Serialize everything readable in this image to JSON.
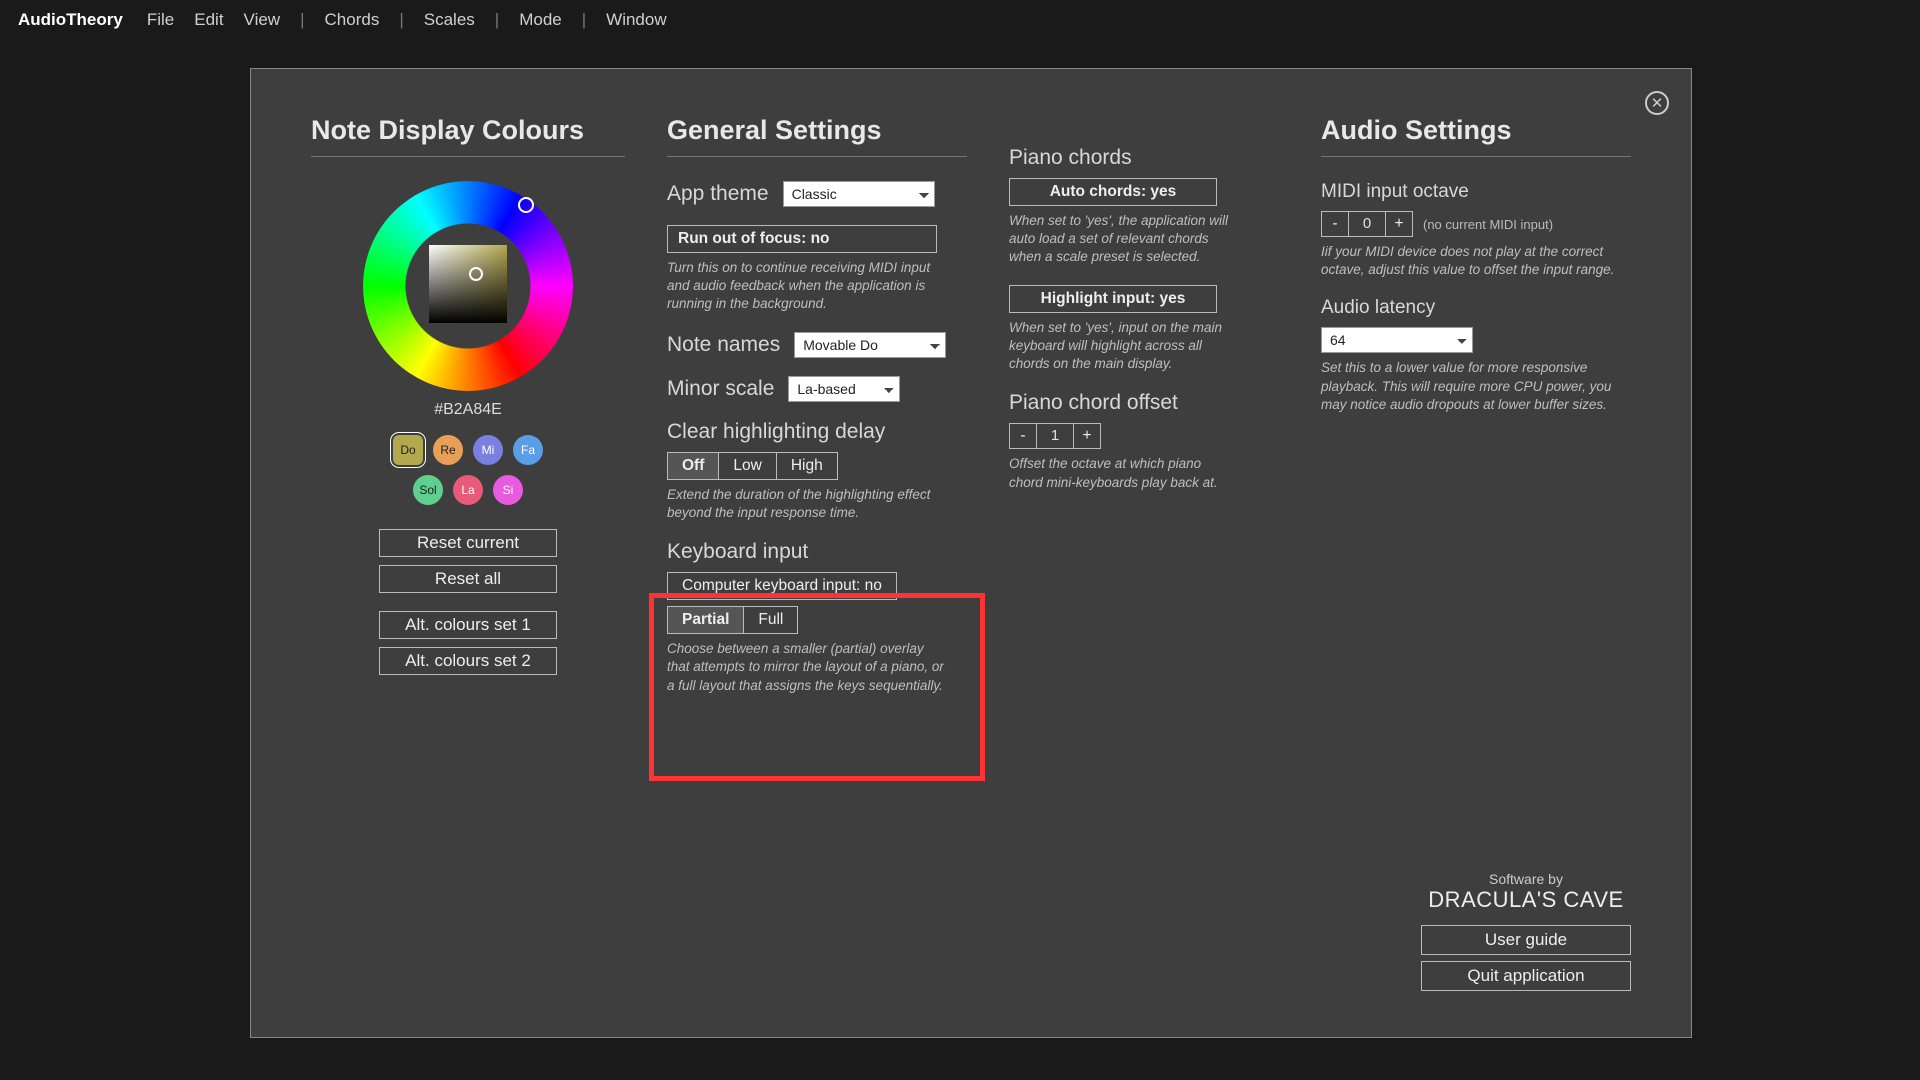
{
  "menubar": {
    "brand": "AudioTheory",
    "items": [
      "File",
      "Edit",
      "View",
      "Chords",
      "Scales",
      "Mode",
      "Window"
    ]
  },
  "headings": {
    "colours": "Note Display Colours",
    "general": "General Settings",
    "audio": "Audio Settings"
  },
  "colours": {
    "hex": "#B2A84E",
    "swatches1": [
      {
        "label": "Do",
        "color": "#b2a84e",
        "sel": true
      },
      {
        "label": "Re",
        "color": "#e8a056"
      },
      {
        "label": "Mi",
        "color": "#7a7fe0"
      },
      {
        "label": "Fa",
        "color": "#5a9ee8"
      }
    ],
    "swatches2": [
      {
        "label": "Sol",
        "color": "#5fcf8f"
      },
      {
        "label": "La",
        "color": "#e85a7a"
      },
      {
        "label": "Si",
        "color": "#e85adf"
      }
    ],
    "reset_current": "Reset current",
    "reset_all": "Reset all",
    "alt1": "Alt. colours set 1",
    "alt2": "Alt. colours set 2"
  },
  "general": {
    "app_theme_label": "App theme",
    "app_theme_value": "Classic",
    "run_focus": "Run out of focus: no",
    "run_focus_help": "Turn this on to continue receiving MIDI input and audio feedback when the application is running in the background.",
    "note_names_label": "Note names",
    "note_names_value": "Movable Do",
    "minor_scale_label": "Minor scale",
    "minor_scale_value": "La-based",
    "clear_label": "Clear highlighting delay",
    "clear_off": "Off",
    "clear_low": "Low",
    "clear_high": "High",
    "clear_help": "Extend the duration of the highlighting effect beyond the input response time.",
    "kb_label": "Keyboard input",
    "kb_toggle": "Computer keyboard input: no",
    "kb_partial": "Partial",
    "kb_full": "Full",
    "kb_help": "Choose between a smaller (partial) overlay that attempts to mirror the layout of a piano, or a full layout that assigns the keys sequentially."
  },
  "piano": {
    "chords_label": "Piano chords",
    "auto_chords": "Auto chords: yes",
    "auto_help": "When set to 'yes', the application will auto load a set of relevant chords when a scale preset is selected.",
    "highlight": "Highlight input: yes",
    "highlight_help": "When set to 'yes', input on the main keyboard will highlight across all chords on the main display.",
    "offset_label": "Piano chord offset",
    "offset_val": "1",
    "offset_help": "Offset the octave at which piano chord mini-keyboards play back at."
  },
  "audio": {
    "midi_label": "MIDI input octave",
    "midi_val": "0",
    "midi_note": "(no current MIDI input)",
    "midi_help": "Iif your MIDI device does not play at the correct octave, adjust this value to offset the input range.",
    "latency_label": "Audio latency",
    "latency_value": "64",
    "latency_help": "Set this to a lower value for more responsive playback. This will require more CPU power, you may notice audio dropouts at lower buffer sizes."
  },
  "credits": {
    "soft": "Software by",
    "drac": "DRACULA'S CAVE",
    "guide": "User guide",
    "quit": "Quit application"
  },
  "glyphs": {
    "minus": "-",
    "plus": "+"
  }
}
